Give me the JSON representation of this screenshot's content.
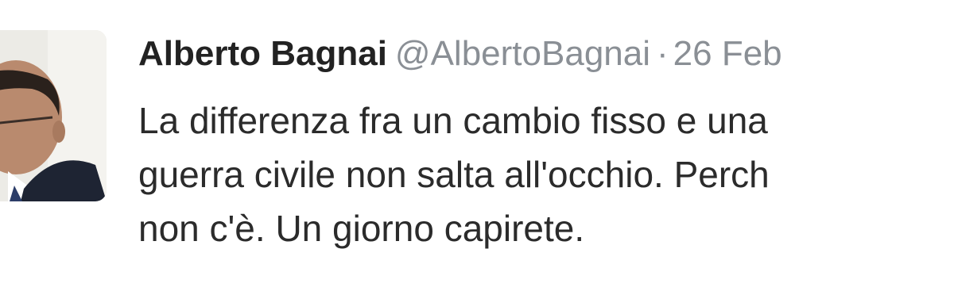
{
  "tweet": {
    "author_name": "Alberto Bagnai",
    "author_handle": "@AlbertoBagnai",
    "separator": "·",
    "timestamp": "26 Feb",
    "text_lines": [
      "La differenza fra un cambio fisso e una",
      "guerra civile non salta all'occhio. Perch",
      "non c'è. Un giorno capirete."
    ]
  },
  "colors": {
    "name": "#222222",
    "secondary": "#8a8f95",
    "body_text": "#2b2b2b",
    "background": "#ffffff"
  },
  "icons": {
    "avatar": "profile-photo"
  }
}
